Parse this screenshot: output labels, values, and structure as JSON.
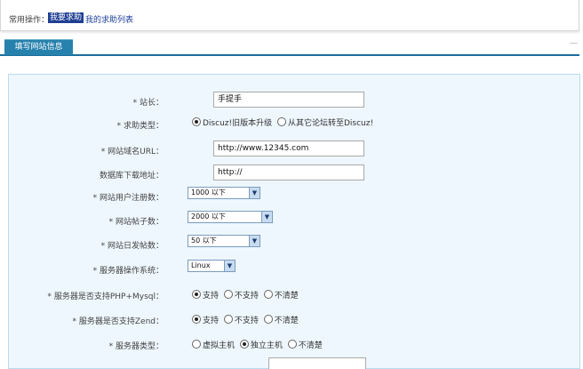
{
  "top": {
    "label": "常用操作：",
    "link_request": "我要求助",
    "link_list": "我的求助列表"
  },
  "tab": {
    "title": "填写网站信息",
    "collapse": "—"
  },
  "form": {
    "webmaster_label": "* 站长：",
    "webmaster_value": "手提手",
    "help_type_label": "* 求助类型：",
    "help_type_options": [
      "Discuz!旧版本升级",
      "从其它论坛转至Discuz!"
    ],
    "site_url_label": "* 网站域名URL：",
    "site_url_value": "http://www.12345.com",
    "db_download_label": "数据库下载地址：",
    "db_download_value": "http://",
    "users_label": "* 网站用户注册数：",
    "users_value": "1000 以下",
    "posts_label": "* 网站帖子数：",
    "posts_value": "2000 以下",
    "daily_label": "* 网站日发帖数：",
    "daily_value": "50 以下",
    "os_label": "* 服务器操作系统：",
    "os_value": "Linux",
    "php_label": "* 服务器是否支持PHP+Mysql：",
    "php_options": [
      "支持",
      "不支持",
      "不清楚"
    ],
    "zend_label": "* 服务器是否支持Zend：",
    "zend_options": [
      "支持",
      "不支持",
      "不清楚"
    ],
    "server_type_label": "* 服务器类型：",
    "server_type_options": [
      "虚拟主机",
      "独立主机",
      "不清楚"
    ]
  }
}
